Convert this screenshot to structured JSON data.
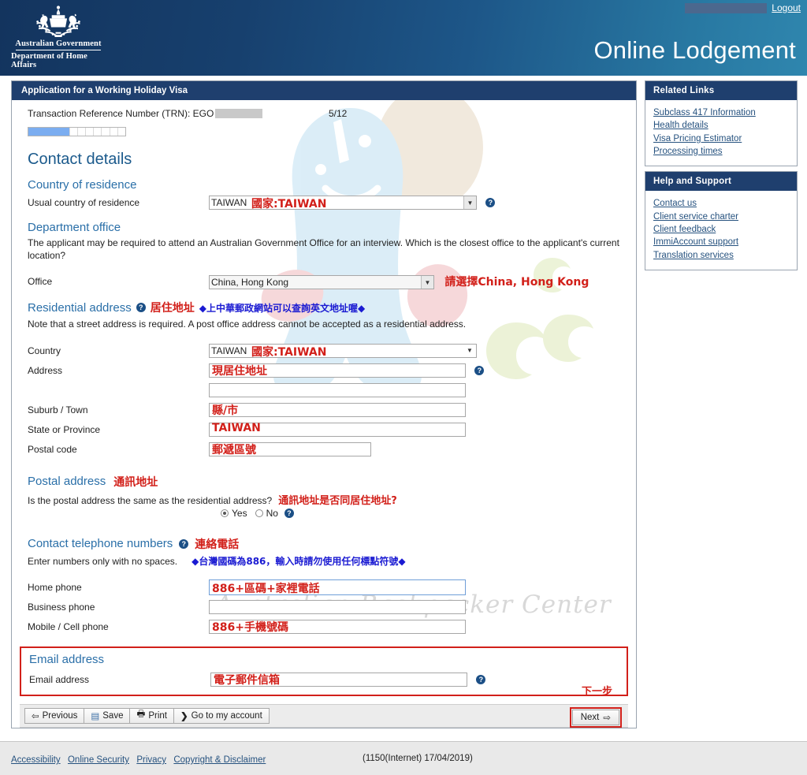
{
  "header": {
    "logout_label": "Logout",
    "app_title": "Online Lodgement",
    "crest_line1": "Australian Government",
    "crest_line2": "Department of Home Affairs",
    "header_gradient_start": "#13345e",
    "header_gradient_end": "#2f86ae"
  },
  "form": {
    "panel_title": "Application for a Working Holiday Visa",
    "trn_label": "Transaction Reference Number (TRN): EGO",
    "page_counter": "5/12",
    "progress_percent": 42,
    "progress_segments": 12,
    "section_title": "Contact details",
    "country_of_residence": {
      "heading": "Country of residence",
      "label": "Usual country of residence",
      "value": "TAIWAN",
      "annotation": "國家:TAIWAN"
    },
    "department_office": {
      "heading": "Department office",
      "note": "The applicant may be required to attend an Australian Government Office for an interview. Which is the closest office to the applicant's current location?",
      "label": "Office",
      "value": "China, Hong Kong",
      "annotation": "請選擇China, Hong Kong"
    },
    "residential_address": {
      "heading": "Residential address",
      "annotation_red": "居住地址",
      "annotation_blue": "◆上中華郵政網站可以查詢英文地址喔◆",
      "note": "Note that a street address is required. A post office address cannot be accepted as a residential address.",
      "country_label": "Country",
      "country_value": "TAIWAN",
      "country_annotation": "國家:TAIWAN",
      "address_label": "Address",
      "address_annotation": "現居住地址",
      "address_line2_value": "",
      "suburb_label": "Suburb / Town",
      "suburb_annotation": "縣/市",
      "state_label": "State or Province",
      "state_annotation": "TAIWAN",
      "postal_code_label": "Postal code",
      "postal_code_annotation": "郵遞區號"
    },
    "postal_address": {
      "heading": "Postal address",
      "annotation": "通訊地址",
      "question": "Is the postal address the same as the residential address?",
      "question_annotation": "通訊地址是否同居住地址?",
      "yes_label": "Yes",
      "no_label": "No",
      "selected": "Yes"
    },
    "telephone": {
      "heading": "Contact telephone numbers",
      "annotation": "連絡電話",
      "note": "Enter numbers only with no spaces.",
      "note_annotation": "◆台灣國碼為886，輸入時請勿使用任何標點符號◆",
      "home_label": "Home phone",
      "home_annotation": "886+區碼+家裡電話",
      "business_label": "Business phone",
      "business_value": "",
      "mobile_label": "Mobile / Cell phone",
      "mobile_annotation": "886+手機號碼"
    },
    "email": {
      "heading": "Email address",
      "label": "Email address",
      "annotation": "電子郵件信箱"
    },
    "buttons": {
      "previous": "Previous",
      "save": "Save",
      "print": "Print",
      "go_to_account": "Go to my account",
      "next": "Next",
      "next_annotation": "下一步"
    }
  },
  "sidebar": {
    "related_links": {
      "title": "Related Links",
      "items": [
        "Subclass 417 Information",
        "Health details",
        "Visa Pricing Estimator",
        "Processing times"
      ]
    },
    "help_support": {
      "title": "Help and Support",
      "items": [
        "Contact us",
        "Client service charter",
        "Client feedback",
        "ImmiAccount support",
        "Translation services"
      ]
    }
  },
  "watermark": {
    "text": "Australian Backpacker Center"
  },
  "footer": {
    "links": [
      "Accessibility",
      "Online Security",
      "Privacy",
      "Copyright & Disclaimer"
    ],
    "build": "(1150(Internet) 17/04/2019)"
  }
}
